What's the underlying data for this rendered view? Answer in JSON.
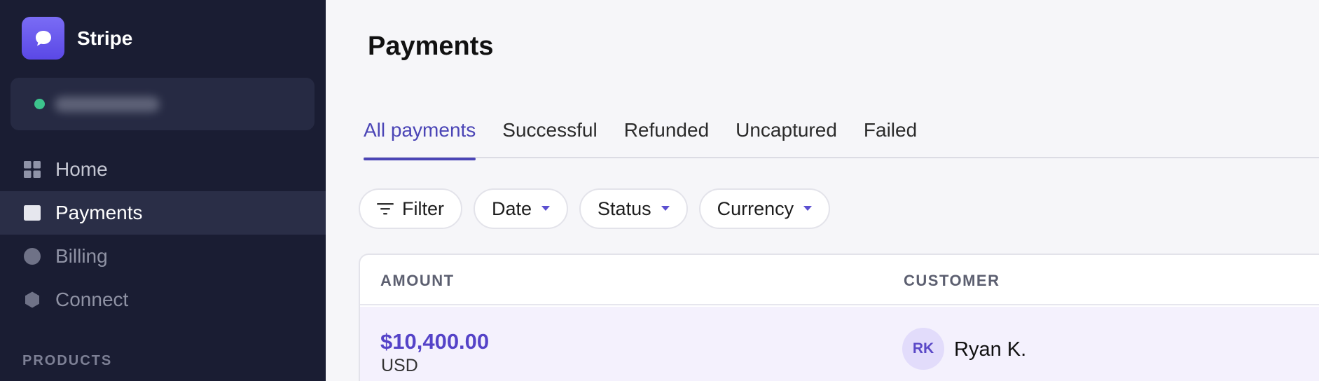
{
  "brand": {
    "name": "Stripe",
    "logo_icon": "chat-bubble-icon",
    "accent": "#635bff"
  },
  "account": {
    "status_color": "#3cc38c"
  },
  "sidebar": {
    "items": [
      {
        "label": "Home",
        "icon": "grid-icon",
        "active": false
      },
      {
        "label": "Payments",
        "icon": "card-icon",
        "active": true
      },
      {
        "label": "Billing",
        "icon": "circle-icon",
        "active": false
      },
      {
        "label": "Connect",
        "icon": "hexagon-icon",
        "active": false
      }
    ],
    "section_label": "PRODUCTS"
  },
  "main": {
    "title": "Payments",
    "tabs": [
      {
        "label": "All payments",
        "active": true
      },
      {
        "label": "Successful",
        "active": false
      },
      {
        "label": "Refunded",
        "active": false
      },
      {
        "label": "Uncaptured",
        "active": false
      },
      {
        "label": "Failed",
        "active": false
      }
    ],
    "filters": {
      "filter_label": "Filter",
      "date_label": "Date",
      "status_label": "Status",
      "currency_label": "Currency"
    },
    "table": {
      "columns": [
        "AMOUNT",
        "CUSTOMER"
      ],
      "rows": [
        {
          "amount": "$10,400.00",
          "currency": "USD",
          "initials": "RK",
          "customer": "Ryan K."
        }
      ]
    }
  }
}
